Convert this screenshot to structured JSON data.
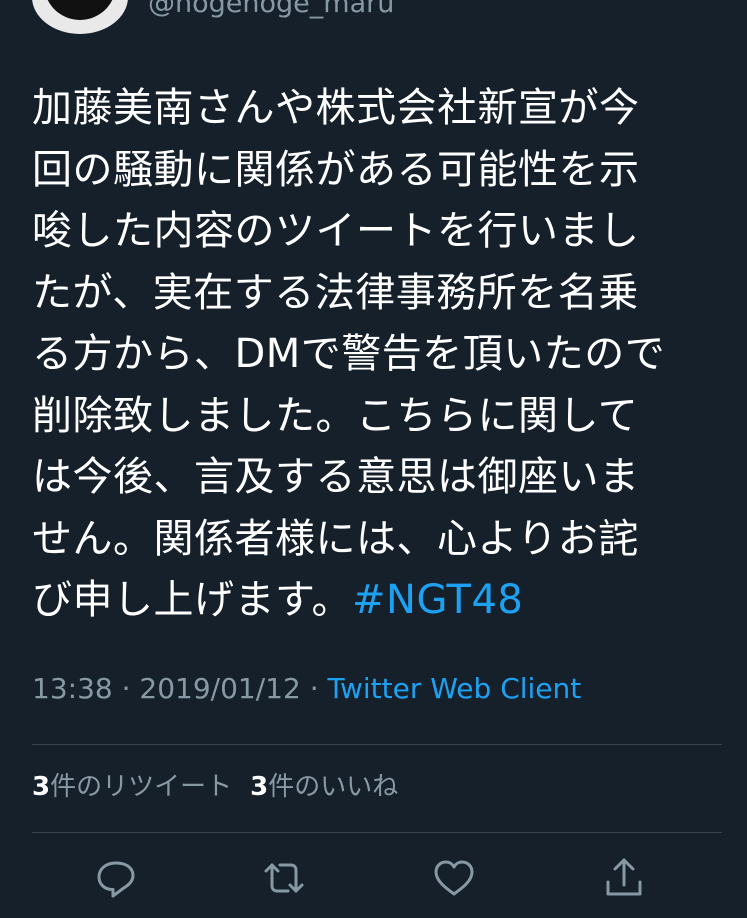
{
  "header": {
    "handle": "@hogehoge_maru"
  },
  "tweet": {
    "lines": [
      "加藤美南さんや株式会社新宣が今",
      "回の騒動に関係がある可能性を示",
      "唆した内容のツイートを行いまし",
      "たが、実在する法律事務所を名乗",
      "る方から、DMで警告を頂いたので",
      "削除致しました。こちらに関して",
      "は今後、言及する意思は御座いま",
      "せん。関係者様には、心よりお詫"
    ],
    "last_line_text": "び申し上げます。",
    "hashtag": "#NGT48"
  },
  "meta": {
    "time": "13:38",
    "separator1": " · ",
    "date": "2019/01/12",
    "separator2": " · ",
    "client": "Twitter Web Client"
  },
  "stats": {
    "retweets_count": "3",
    "retweets_label": "件のリツイート",
    "likes_count": "3",
    "likes_label": "件のいいね"
  },
  "actions": {
    "icons": [
      "reply-icon",
      "retweet-icon",
      "like-icon",
      "share-icon"
    ],
    "icon_color": "#8899a6"
  },
  "colors": {
    "background": "#15202b",
    "text": "#ffffff",
    "secondary": "#8899a6",
    "accent": "#1da1f2",
    "divider": "#38444d"
  }
}
